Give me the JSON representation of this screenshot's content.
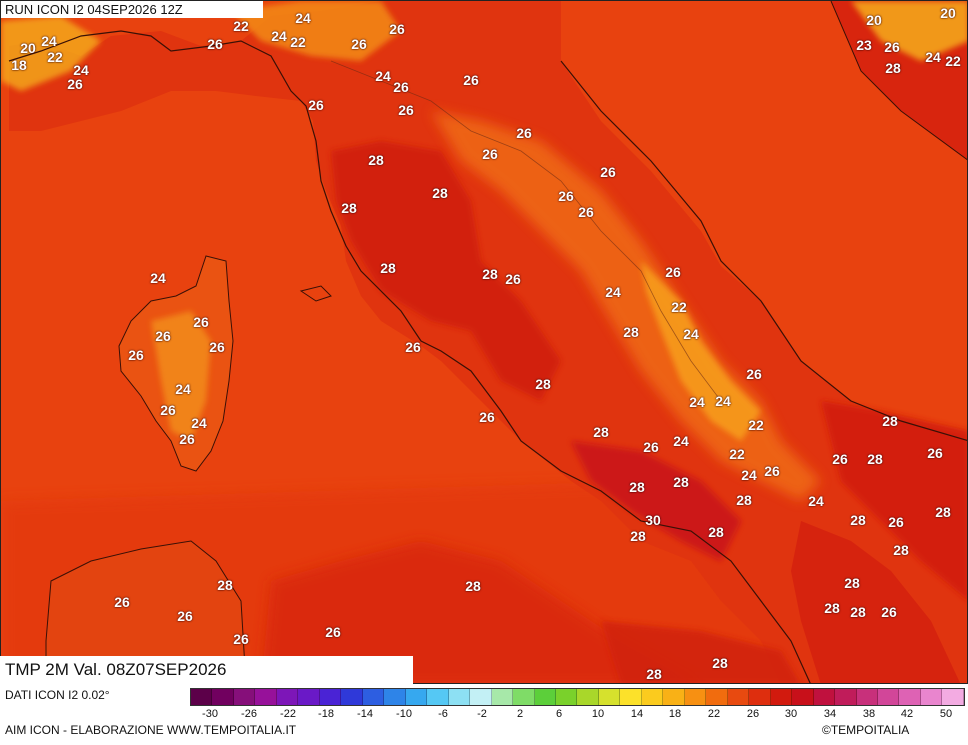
{
  "header": {
    "run": "RUN ICON I2 04SEP2026 12Z",
    "valid": "TMP 2M Val. 08Z07SEP2026"
  },
  "footer": {
    "data_source": "DATI ICON I2 0.02°",
    "credits": "AIM ICON - ELABORAZIONE WWW.TEMPOITALIA.IT",
    "copyright": "©TEMPOITALIA"
  },
  "colorbar": {
    "colors": [
      "#5c0049",
      "#71005f",
      "#860f7a",
      "#97119a",
      "#7d16b8",
      "#6a19c7",
      "#4a23d5",
      "#2f39d9",
      "#2d5ee1",
      "#2e84e8",
      "#36a8ef",
      "#55c8f4",
      "#8de0f3",
      "#c3f0f5",
      "#a7e8a9",
      "#7fdc67",
      "#5ccf3a",
      "#7ad12b",
      "#a9d72a",
      "#d6e12d",
      "#fce12a",
      "#fbcb1e",
      "#f9b116",
      "#f79012",
      "#f16c0e",
      "#e84a10",
      "#de2e0e",
      "#d21a0e",
      "#c8101a",
      "#c0113e",
      "#c01c5a",
      "#c8307b",
      "#d24699",
      "#de62b4",
      "#e985ce",
      "#f3abe2"
    ],
    "ticks": [
      "-30",
      "-26",
      "-22",
      "-18",
      "-14",
      "-10",
      "-6",
      "-2",
      "2",
      "6",
      "10",
      "14",
      "18",
      "22",
      "26",
      "30",
      "34",
      "38",
      "42",
      "50"
    ]
  },
  "labels": [
    {
      "v": "24"
    },
    {
      "v": "26"
    },
    {
      "v": "20"
    },
    {
      "v": "24"
    },
    {
      "v": "22"
    },
    {
      "v": "18"
    },
    {
      "v": "24"
    },
    {
      "v": "26"
    },
    {
      "v": "26"
    },
    {
      "v": "22"
    },
    {
      "v": "24"
    },
    {
      "v": "22"
    },
    {
      "v": "26"
    },
    {
      "v": "24"
    },
    {
      "v": "26"
    },
    {
      "v": "26"
    },
    {
      "v": "26"
    },
    {
      "v": "26"
    },
    {
      "v": "26"
    },
    {
      "v": "20"
    },
    {
      "v": "20"
    },
    {
      "v": "23"
    },
    {
      "v": "26"
    },
    {
      "v": "28"
    },
    {
      "v": "24"
    },
    {
      "v": "22"
    },
    {
      "v": "26"
    },
    {
      "v": "28"
    },
    {
      "v": "28"
    },
    {
      "v": "28"
    },
    {
      "v": "26"
    },
    {
      "v": "26"
    },
    {
      "v": "26"
    },
    {
      "v": "28"
    },
    {
      "v": "28"
    },
    {
      "v": "26"
    },
    {
      "v": "26"
    },
    {
      "v": "24"
    },
    {
      "v": "22"
    },
    {
      "v": "24"
    },
    {
      "v": "28"
    },
    {
      "v": "24"
    },
    {
      "v": "26"
    },
    {
      "v": "26"
    },
    {
      "v": "26"
    },
    {
      "v": "26"
    },
    {
      "v": "24"
    },
    {
      "v": "26"
    },
    {
      "v": "24"
    },
    {
      "v": "26"
    },
    {
      "v": "28"
    },
    {
      "v": "26"
    },
    {
      "v": "24"
    },
    {
      "v": "24"
    },
    {
      "v": "22"
    },
    {
      "v": "28"
    },
    {
      "v": "26"
    },
    {
      "v": "24"
    },
    {
      "v": "22"
    },
    {
      "v": "24"
    },
    {
      "v": "26"
    },
    {
      "v": "26"
    },
    {
      "v": "28"
    },
    {
      "v": "26"
    },
    {
      "v": "28"
    },
    {
      "v": "28"
    },
    {
      "v": "28"
    },
    {
      "v": "30"
    },
    {
      "v": "28"
    },
    {
      "v": "28"
    },
    {
      "v": "24"
    },
    {
      "v": "28"
    },
    {
      "v": "26"
    },
    {
      "v": "28"
    },
    {
      "v": "26"
    },
    {
      "v": "26"
    },
    {
      "v": "28"
    },
    {
      "v": "28"
    },
    {
      "v": "28"
    },
    {
      "v": "26"
    },
    {
      "v": "26"
    },
    {
      "v": "28"
    },
    {
      "v": "26"
    },
    {
      "v": "26"
    },
    {
      "v": "28"
    },
    {
      "v": "28"
    },
    {
      "v": "28"
    },
    {
      "v": "28"
    },
    {
      "v": "28"
    },
    {
      "v": "26"
    }
  ]
}
